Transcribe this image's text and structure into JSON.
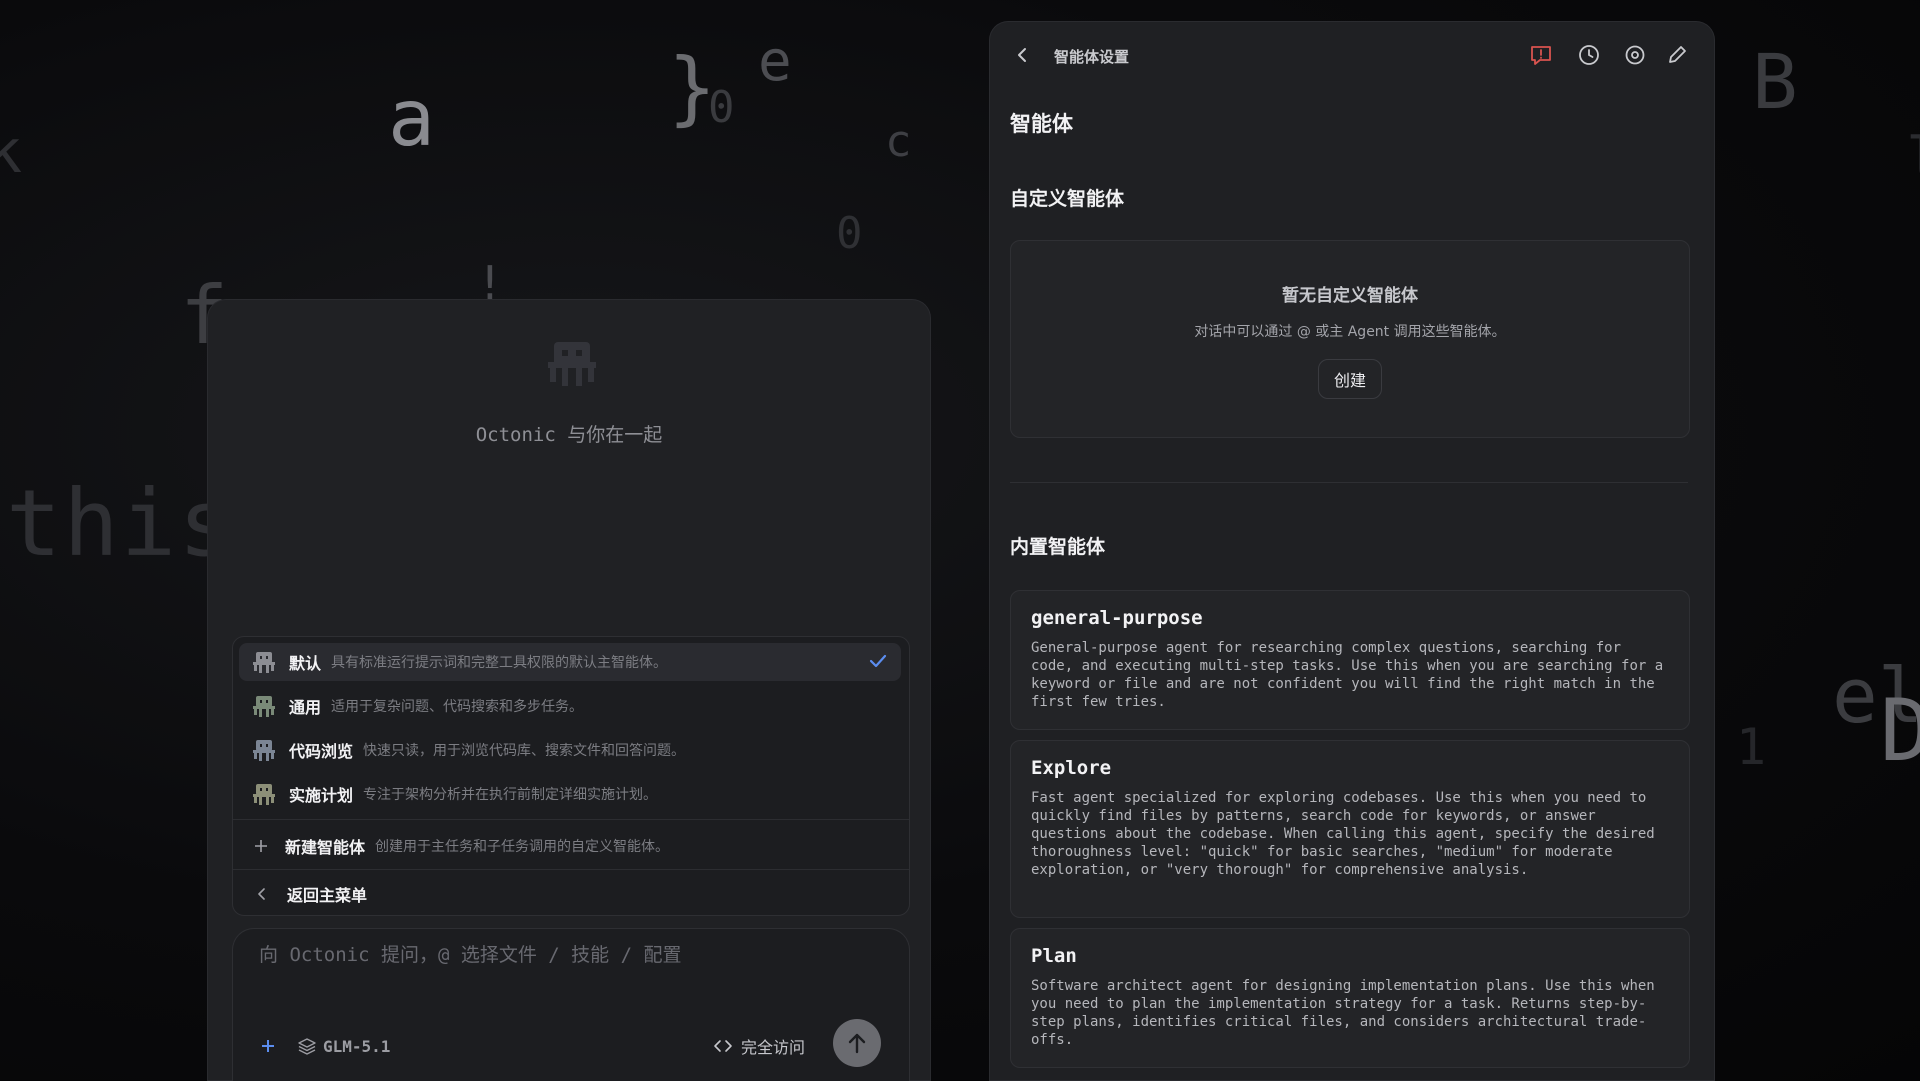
{
  "background_glyphs": {
    "a": "a",
    "brace": "}",
    "zero_a": "0",
    "e": "e",
    "c": "c",
    "zero_b": "0",
    "f": "f",
    "bang": "!",
    "k": "k",
    "this": "this",
    "B": "B",
    "l": "l",
    "el": "el",
    "D": "D",
    "one": "1"
  },
  "left_panel": {
    "mascot_icon": "octopus-icon",
    "tagline": "Octonic 与你在一起",
    "agent_menu": {
      "items": [
        {
          "name": "默认",
          "description": "具有标准运行提示词和完整工具权限的默认主智能体。",
          "selected": true
        },
        {
          "name": "通用",
          "description": "适用于复杂问题、代码搜索和多步任务。",
          "selected": false
        },
        {
          "name": "代码浏览",
          "description": "快速只读，用于浏览代码库、搜索文件和回答问题。",
          "selected": false
        },
        {
          "name": "实施计划",
          "description": "专注于架构分析并在执行前制定详细实施计划。",
          "selected": false
        }
      ],
      "new_agent": {
        "label": "新建智能体",
        "description": "创建用于主任务和子任务调用的自定义智能体。"
      },
      "back_label": "返回主菜单"
    },
    "composer": {
      "placeholder": "向 Octonic 提问，@ 选择文件 / 技能 / 配置",
      "model": "GLM-5.1",
      "access_mode": "完全访问"
    }
  },
  "right_panel": {
    "topbar_title": "智能体设置",
    "topbar_icons": [
      "feedback-icon",
      "history-icon",
      "settings-icon",
      "edit-icon"
    ],
    "page_title": "智能体",
    "custom_section": {
      "title": "自定义智能体",
      "empty_title": "暂无自定义智能体",
      "empty_desc": "对话中可以通过 @ 或主 Agent 调用这些智能体。",
      "create_label": "创建"
    },
    "builtin_section": {
      "title": "内置智能体",
      "agents": [
        {
          "name": "general-purpose",
          "description": "General-purpose agent for researching complex questions, searching for code, and executing multi-step tasks. Use this when you are searching for a keyword or file and are not confident you will find the right match in the first few tries."
        },
        {
          "name": "Explore",
          "description": "Fast agent specialized for exploring codebases. Use this when you need to quickly find files by patterns, search code for keywords, or answer questions about the codebase. When calling this agent, specify the desired thoroughness level: \"quick\" for basic searches, \"medium\" for moderate exploration, or \"very thorough\" for comprehensive analysis."
        },
        {
          "name": "Plan",
          "description": "Software architect agent for designing implementation plans. Use this when you need to plan the implementation strategy for a task. Returns step-by-step plans, identifies critical files, and considers architectural trade-offs."
        }
      ]
    }
  },
  "colors": {
    "accent_check": "#5b8def",
    "feedback_icon": "#d9534f",
    "panel_bg": "#1f2023",
    "card_bg": "#232427"
  }
}
